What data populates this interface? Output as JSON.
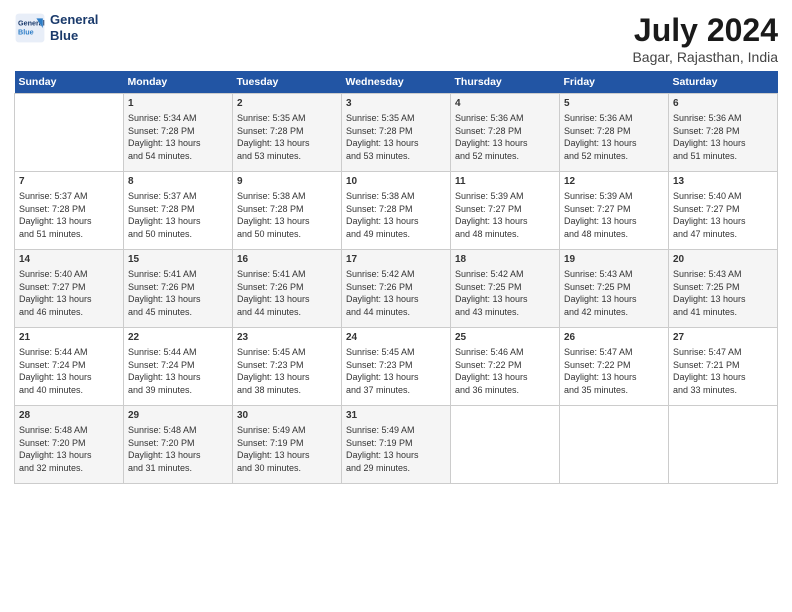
{
  "logo": {
    "line1": "General",
    "line2": "Blue"
  },
  "title": "July 2024",
  "subtitle": "Bagar, Rajasthan, India",
  "headers": [
    "Sunday",
    "Monday",
    "Tuesday",
    "Wednesday",
    "Thursday",
    "Friday",
    "Saturday"
  ],
  "weeks": [
    [
      {
        "day": "",
        "info": ""
      },
      {
        "day": "1",
        "info": "Sunrise: 5:34 AM\nSunset: 7:28 PM\nDaylight: 13 hours\nand 54 minutes."
      },
      {
        "day": "2",
        "info": "Sunrise: 5:35 AM\nSunset: 7:28 PM\nDaylight: 13 hours\nand 53 minutes."
      },
      {
        "day": "3",
        "info": "Sunrise: 5:35 AM\nSunset: 7:28 PM\nDaylight: 13 hours\nand 53 minutes."
      },
      {
        "day": "4",
        "info": "Sunrise: 5:36 AM\nSunset: 7:28 PM\nDaylight: 13 hours\nand 52 minutes."
      },
      {
        "day": "5",
        "info": "Sunrise: 5:36 AM\nSunset: 7:28 PM\nDaylight: 13 hours\nand 52 minutes."
      },
      {
        "day": "6",
        "info": "Sunrise: 5:36 AM\nSunset: 7:28 PM\nDaylight: 13 hours\nand 51 minutes."
      }
    ],
    [
      {
        "day": "7",
        "info": "Sunrise: 5:37 AM\nSunset: 7:28 PM\nDaylight: 13 hours\nand 51 minutes."
      },
      {
        "day": "8",
        "info": "Sunrise: 5:37 AM\nSunset: 7:28 PM\nDaylight: 13 hours\nand 50 minutes."
      },
      {
        "day": "9",
        "info": "Sunrise: 5:38 AM\nSunset: 7:28 PM\nDaylight: 13 hours\nand 50 minutes."
      },
      {
        "day": "10",
        "info": "Sunrise: 5:38 AM\nSunset: 7:28 PM\nDaylight: 13 hours\nand 49 minutes."
      },
      {
        "day": "11",
        "info": "Sunrise: 5:39 AM\nSunset: 7:27 PM\nDaylight: 13 hours\nand 48 minutes."
      },
      {
        "day": "12",
        "info": "Sunrise: 5:39 AM\nSunset: 7:27 PM\nDaylight: 13 hours\nand 48 minutes."
      },
      {
        "day": "13",
        "info": "Sunrise: 5:40 AM\nSunset: 7:27 PM\nDaylight: 13 hours\nand 47 minutes."
      }
    ],
    [
      {
        "day": "14",
        "info": "Sunrise: 5:40 AM\nSunset: 7:27 PM\nDaylight: 13 hours\nand 46 minutes."
      },
      {
        "day": "15",
        "info": "Sunrise: 5:41 AM\nSunset: 7:26 PM\nDaylight: 13 hours\nand 45 minutes."
      },
      {
        "day": "16",
        "info": "Sunrise: 5:41 AM\nSunset: 7:26 PM\nDaylight: 13 hours\nand 44 minutes."
      },
      {
        "day": "17",
        "info": "Sunrise: 5:42 AM\nSunset: 7:26 PM\nDaylight: 13 hours\nand 44 minutes."
      },
      {
        "day": "18",
        "info": "Sunrise: 5:42 AM\nSunset: 7:25 PM\nDaylight: 13 hours\nand 43 minutes."
      },
      {
        "day": "19",
        "info": "Sunrise: 5:43 AM\nSunset: 7:25 PM\nDaylight: 13 hours\nand 42 minutes."
      },
      {
        "day": "20",
        "info": "Sunrise: 5:43 AM\nSunset: 7:25 PM\nDaylight: 13 hours\nand 41 minutes."
      }
    ],
    [
      {
        "day": "21",
        "info": "Sunrise: 5:44 AM\nSunset: 7:24 PM\nDaylight: 13 hours\nand 40 minutes."
      },
      {
        "day": "22",
        "info": "Sunrise: 5:44 AM\nSunset: 7:24 PM\nDaylight: 13 hours\nand 39 minutes."
      },
      {
        "day": "23",
        "info": "Sunrise: 5:45 AM\nSunset: 7:23 PM\nDaylight: 13 hours\nand 38 minutes."
      },
      {
        "day": "24",
        "info": "Sunrise: 5:45 AM\nSunset: 7:23 PM\nDaylight: 13 hours\nand 37 minutes."
      },
      {
        "day": "25",
        "info": "Sunrise: 5:46 AM\nSunset: 7:22 PM\nDaylight: 13 hours\nand 36 minutes."
      },
      {
        "day": "26",
        "info": "Sunrise: 5:47 AM\nSunset: 7:22 PM\nDaylight: 13 hours\nand 35 minutes."
      },
      {
        "day": "27",
        "info": "Sunrise: 5:47 AM\nSunset: 7:21 PM\nDaylight: 13 hours\nand 33 minutes."
      }
    ],
    [
      {
        "day": "28",
        "info": "Sunrise: 5:48 AM\nSunset: 7:20 PM\nDaylight: 13 hours\nand 32 minutes."
      },
      {
        "day": "29",
        "info": "Sunrise: 5:48 AM\nSunset: 7:20 PM\nDaylight: 13 hours\nand 31 minutes."
      },
      {
        "day": "30",
        "info": "Sunrise: 5:49 AM\nSunset: 7:19 PM\nDaylight: 13 hours\nand 30 minutes."
      },
      {
        "day": "31",
        "info": "Sunrise: 5:49 AM\nSunset: 7:19 PM\nDaylight: 13 hours\nand 29 minutes."
      },
      {
        "day": "",
        "info": ""
      },
      {
        "day": "",
        "info": ""
      },
      {
        "day": "",
        "info": ""
      }
    ]
  ]
}
